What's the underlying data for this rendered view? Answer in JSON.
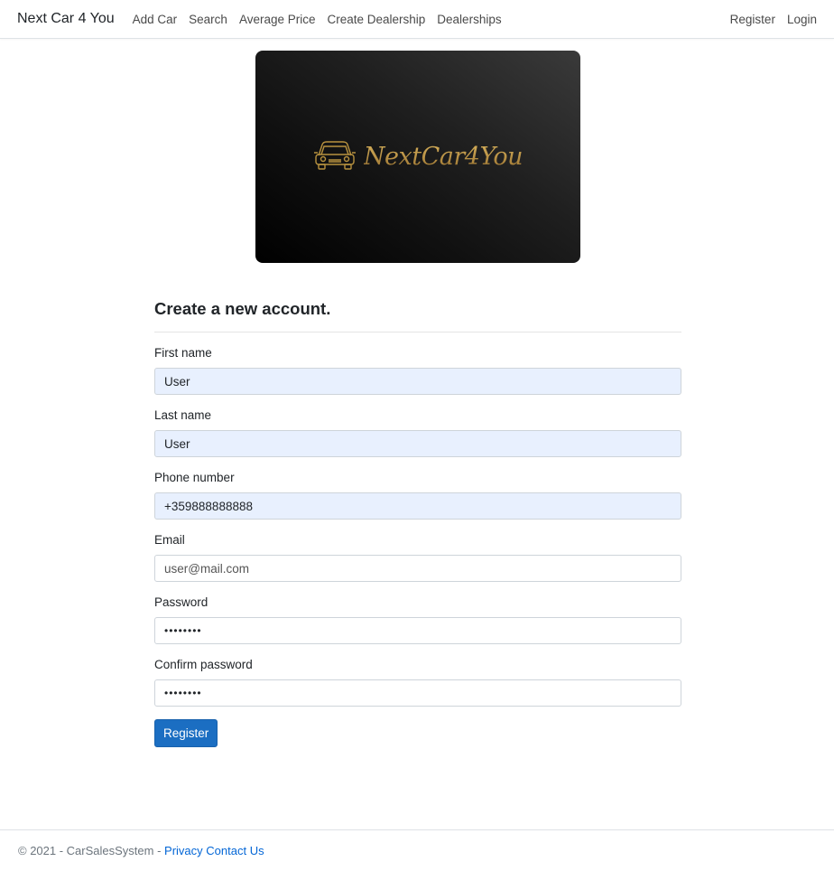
{
  "navbar": {
    "brand": "Next Car 4 You",
    "links": [
      "Add Car",
      "Search",
      "Average Price",
      "Create Dealership",
      "Dealerships"
    ],
    "right_links": [
      "Register",
      "Login"
    ]
  },
  "banner": {
    "logo_text": "NextCar4You",
    "logo_icon": "car-icon",
    "accent_color": "#b8923f"
  },
  "form": {
    "title": "Create a new account.",
    "fields": [
      {
        "label": "First name",
        "value": "User",
        "placeholder": ""
      },
      {
        "label": "Last name",
        "value": "User",
        "placeholder": ""
      },
      {
        "label": "Phone number",
        "value": "+359888888888",
        "placeholder": ""
      },
      {
        "label": "Email",
        "value": "",
        "placeholder": "user@mail.com"
      },
      {
        "label": "Password",
        "value": "••••••••",
        "placeholder": ""
      },
      {
        "label": "Confirm password",
        "value": "••••••••",
        "placeholder": ""
      }
    ],
    "submit_label": "Register",
    "button_color": "#1b6ec2"
  },
  "footer": {
    "copyright": "© 2021 - CarSalesSystem - ",
    "privacy_link": "Privacy",
    "contact_link": "Contact Us"
  }
}
